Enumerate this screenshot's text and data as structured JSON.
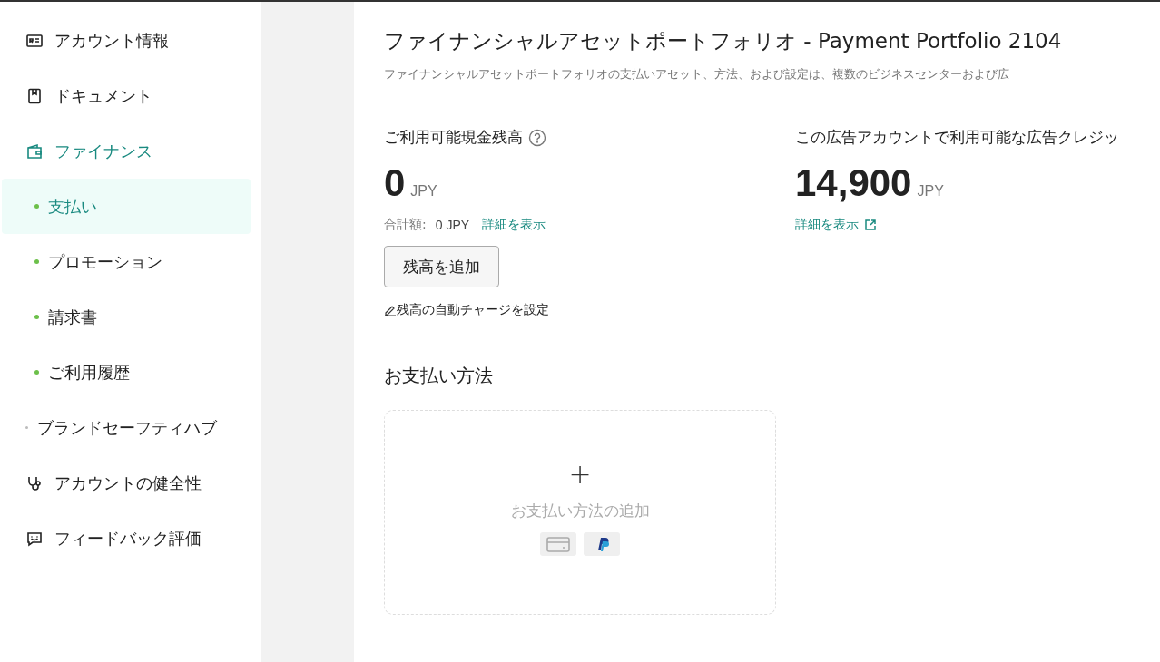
{
  "sidebar": {
    "items": [
      {
        "kind": "section",
        "label": "アカウント情報",
        "selected": false
      },
      {
        "kind": "section",
        "label": "ドキュメント",
        "selected": false
      },
      {
        "kind": "section",
        "label": "ファイナンス",
        "selected": true
      },
      {
        "kind": "sub",
        "label": "支払い",
        "selected": true
      },
      {
        "kind": "sub",
        "label": "プロモーション",
        "selected": false
      },
      {
        "kind": "sub",
        "label": "請求書",
        "selected": false
      },
      {
        "kind": "sub",
        "label": "ご利用履歴",
        "selected": false
      },
      {
        "kind": "plain",
        "label": "ブランドセーフティハブ",
        "selected": false
      },
      {
        "kind": "section",
        "label": "アカウントの健全性",
        "selected": false
      },
      {
        "kind": "section",
        "label": "フィードバック評価",
        "selected": false
      }
    ]
  },
  "page": {
    "title": "ファイナンシャルアセットポートフォリオ - Payment Portfolio 2104",
    "description": "ファイナンシャルアセットポートフォリオの支払いアセット、方法、および設定は、複数のビジネスセンターおよび広"
  },
  "cash_balance": {
    "label": "ご利用可能現金残高",
    "amount": "0",
    "currency": "JPY",
    "total_label": "合計額:",
    "total_value": "0 JPY",
    "details_link": "詳細を表示",
    "add_button": "残高を追加",
    "auto_charge_link": "残高の自動チャージを設定"
  },
  "ad_credit": {
    "label": "この広告アカウントで利用可能な広告クレジッ",
    "amount": "14,900",
    "currency": "JPY",
    "details_link": "詳細を表示"
  },
  "payment_methods": {
    "heading": "お支払い方法",
    "plus": "+",
    "add_label": "お支払い方法の追加"
  }
}
